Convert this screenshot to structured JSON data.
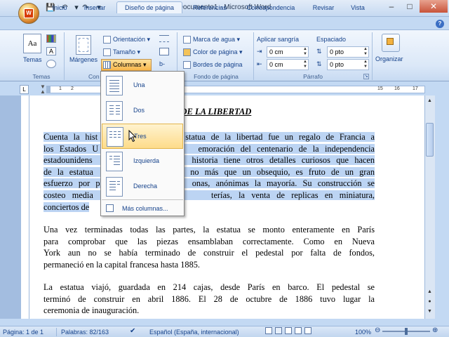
{
  "window": {
    "title": "Documento1 - Microsoft Word"
  },
  "quick_access": {
    "save_icon": "save-icon",
    "undo_icon": "undo-icon",
    "redo_icon": "redo-icon",
    "customize_icon": "customize-icon"
  },
  "tabs": [
    {
      "label": "Inicio"
    },
    {
      "label": "Insertar"
    },
    {
      "label": "Diseño de página"
    },
    {
      "label": "Referencias"
    },
    {
      "label": "Correspondencia"
    },
    {
      "label": "Revisar"
    },
    {
      "label": "Vista"
    }
  ],
  "ribbon": {
    "temas": {
      "button": "Temas",
      "group": "Temas"
    },
    "config": {
      "margenes": "Márgenes",
      "orientacion": "Orientación",
      "tamano": "Tamaño",
      "columnas": "Columnas",
      "group": "Con"
    },
    "fondo": {
      "marca_agua": "Marca de agua",
      "color_pagina": "Color de página",
      "bordes_pagina": "Bordes de página",
      "group": "Fondo de página"
    },
    "parrafo": {
      "aplicar_sangria": "Aplicar sangría",
      "espaciado": "Espaciado",
      "sangria_izq": "0 cm",
      "sangria_der": "0 cm",
      "espacio_antes": "0 pto",
      "espacio_despues": "0 pto",
      "group": "Párrafo"
    },
    "organizar": {
      "button": "Organizar"
    }
  },
  "ruler": {
    "left_marks": [
      "1",
      "2"
    ],
    "right_marks": [
      "15",
      "16",
      "17"
    ]
  },
  "columns_menu": {
    "items": [
      {
        "label": "Una"
      },
      {
        "label": "Dos"
      },
      {
        "label": "Tres"
      },
      {
        "label": "Izquierda"
      },
      {
        "label": "Derecha"
      }
    ],
    "more": "Más columnas..."
  },
  "document": {
    "heading": "UA  DE LA LIBERTAD",
    "para1": [
      "Cuenta la hist                statua de la libertad fue un regalo de Francia a",
      "los Estados U                 emoración del centenario de la independencia",
      "estadounidens                 historia tiene otros detalles curiosos que hacen",
      "de la estatua                 no más que un obsequio, es fruto de un gran",
      "esfuerzo por p                onas, anónimas la mayoría. Su construcción se",
      "costeo media                  terías, la venta de replicas en miniatura,",
      "conciertos de"
    ],
    "para2": [
      "Una vez terminadas todas las partes, la estatua se monto enteramente en París",
      "para comprobar que las piezas ensamblaban correctamente. Como en Nueva",
      "York aun no se había terminado de construir el pedestal por falta de fondos,",
      "permaneció en la capital francesa hasta 1885."
    ],
    "para3": [
      "La estatua viajó, guardada en 214 cajas, desde París en barco. El pedestal se",
      "terminó de construir en abril 1886. El 28 de octubre de 1886 tuvo lugar la",
      "ceremonia de inauguración."
    ]
  },
  "status": {
    "page": "Página: 1 de 1",
    "words": "Palabras: 82/163",
    "language": "Español (España, internacional)",
    "zoom": "100%",
    "zoom_level": 100
  }
}
